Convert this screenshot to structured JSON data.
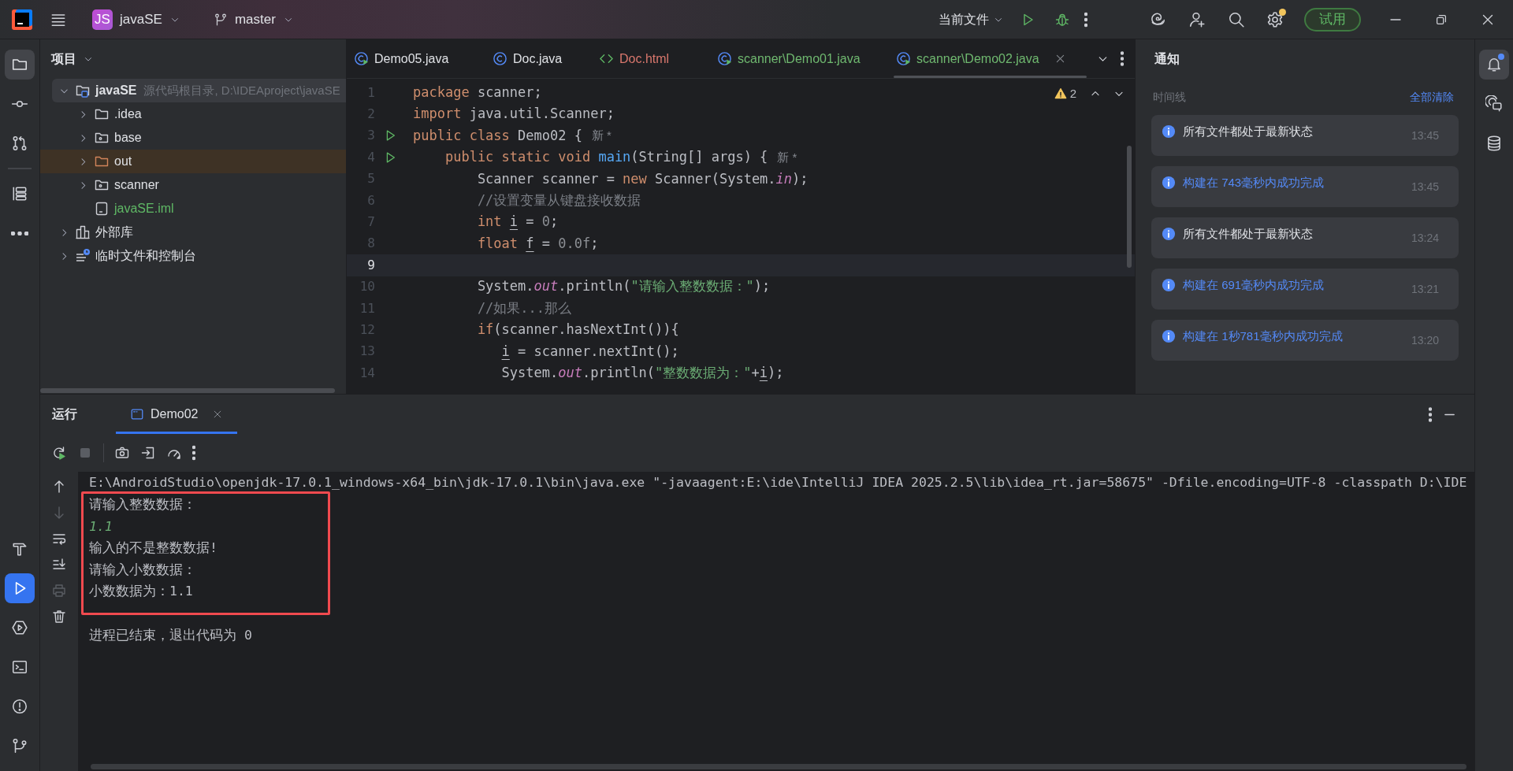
{
  "title_bar": {
    "project_badge": "JS",
    "project": "javaSE",
    "branch": "master",
    "run_config": "当前文件",
    "trial_button": "试用"
  },
  "left_toolbar": {
    "top": [
      {
        "selected": true
      },
      {
        "selected": false
      },
      {
        "selected": false
      },
      {
        "selected": false
      },
      {
        "selected": false
      }
    ],
    "bottom": [
      {
        "selected": false
      },
      {
        "selected": true
      },
      {
        "selected": false
      },
      {
        "selected": false
      },
      {
        "selected": false
      },
      {
        "selected": false
      }
    ]
  },
  "project_panel": {
    "title": "项目",
    "tree": [
      {
        "label": "javaSE",
        "hint": "源代码根目录, D:\\IDEAproject\\javaSE",
        "kind": "module",
        "expanded": true,
        "selected": true,
        "color": "#dfe1e5",
        "children": [
          {
            "label": ".idea",
            "kind": "folder",
            "expanded": false,
            "selected": false,
            "color": "#dfe1e5"
          },
          {
            "label": "base",
            "kind": "package",
            "expanded": false,
            "selected": false,
            "color": "#dfe1e5"
          },
          {
            "label": "out",
            "kind": "excluded",
            "expanded": false,
            "selected": false,
            "color": "#dfe1e5"
          },
          {
            "label": "scanner",
            "kind": "package",
            "expanded": false,
            "selected": false,
            "color": "#dfe1e5"
          },
          {
            "label": "javaSE.iml",
            "kind": "file",
            "selected": false,
            "color": "#5fb865"
          }
        ]
      },
      {
        "label": "外部库",
        "kind": "library",
        "expanded": false,
        "selected": false,
        "color": "#dfe1e5"
      },
      {
        "label": "临时文件和控制台",
        "kind": "scratches",
        "expanded": false,
        "selected": false,
        "color": "#dfe1e5"
      }
    ]
  },
  "editor": {
    "tabs": [
      {
        "label": "Demo05.java",
        "kind": "runnable-class",
        "color": "#dfe1e5",
        "selected": false
      },
      {
        "label": "Doc.java",
        "kind": "class",
        "color": "#dfe1e5",
        "selected": false
      },
      {
        "label": "Doc.html",
        "kind": "html",
        "color": "#d9776d",
        "selected": false
      },
      {
        "label": "scanner\\Demo01.java",
        "kind": "runnable-class",
        "color": "#6fb86f",
        "selected": false
      },
      {
        "label": "scanner\\Demo02.java",
        "kind": "runnable-class",
        "color": "#6fb86f",
        "selected": true
      }
    ],
    "warnings": "2",
    "lines": [
      {
        "number": "1",
        "current": false,
        "runnable": false,
        "segs": [
          {
            "keyword": "package"
          },
          {
            "plain": " scanner;"
          }
        ]
      },
      {
        "number": "2",
        "current": false,
        "runnable": false,
        "segs": [
          {
            "keyword": "import"
          },
          {
            "plain": " java.util.Scanner;"
          }
        ]
      },
      {
        "number": "3",
        "current": false,
        "runnable": true,
        "hint": "新 *",
        "segs": [
          {
            "keyword": "public class"
          },
          {
            "plain": " Demo02 {"
          }
        ]
      },
      {
        "number": "4",
        "current": false,
        "runnable": true,
        "hint": "新 *",
        "segs": [
          {
            "keyword": "    public static void "
          },
          {
            "function": "main"
          },
          {
            "plain": "(String[] args) {"
          }
        ]
      },
      {
        "number": "5",
        "current": false,
        "runnable": false,
        "segs": [
          {
            "plain": "        Scanner scanner = "
          },
          {
            "keyword": "new"
          },
          {
            "plain": " Scanner(System."
          },
          {
            "static_field": "in"
          },
          {
            "plain": ");"
          }
        ]
      },
      {
        "number": "6",
        "current": false,
        "runnable": false,
        "segs": [
          {
            "comment": "        //设置变量从键盘接收数据"
          }
        ]
      },
      {
        "number": "7",
        "current": false,
        "runnable": false,
        "segs": [
          {
            "keyword": "        int "
          },
          {
            "variable": "i"
          },
          {
            "plain": " = "
          },
          {
            "number": "0"
          },
          {
            "plain": ";"
          }
        ]
      },
      {
        "number": "8",
        "current": false,
        "runnable": false,
        "segs": [
          {
            "keyword": "        float "
          },
          {
            "variable": "f"
          },
          {
            "plain": " = "
          },
          {
            "number": "0.0f"
          },
          {
            "plain": ";"
          }
        ]
      },
      {
        "number": "9",
        "current": true,
        "runnable": false
      },
      {
        "number": "10",
        "current": false,
        "runnable": false,
        "segs": [
          {
            "plain": "        System."
          },
          {
            "static_field": "out"
          },
          {
            "plain": ".println("
          },
          {
            "string": "\"请输入整数数据：\""
          },
          {
            "plain": ");"
          }
        ]
      },
      {
        "number": "11",
        "current": false,
        "runnable": false,
        "segs": [
          {
            "comment": "        //如果...那么"
          }
        ]
      },
      {
        "number": "12",
        "current": false,
        "runnable": false,
        "segs": [
          {
            "keyword": "        if"
          },
          {
            "plain": "(scanner.hasNextInt()){"
          }
        ]
      },
      {
        "number": "13",
        "current": false,
        "runnable": false,
        "segs": [
          {
            "variable": "           i"
          },
          {
            "plain": " = scanner.nextInt();"
          }
        ]
      },
      {
        "number": "14",
        "current": false,
        "runnable": false,
        "segs": [
          {
            "plain": "           System."
          },
          {
            "static_field": "out"
          },
          {
            "plain": ".println("
          },
          {
            "string": "\"整数数据为：\""
          },
          {
            "plain": "+"
          },
          {
            "variable": "i"
          },
          {
            "plain": ");"
          }
        ]
      }
    ]
  },
  "notifications": {
    "title": "通知",
    "section": "时间线",
    "clear_all": "全部清除",
    "items": [
      {
        "message": "所有文件都处于最新状态",
        "time": "13:45",
        "link": false
      },
      {
        "message": "构建在 743毫秒内成功完成",
        "time": "13:45",
        "link": true
      },
      {
        "message": "所有文件都处于最新状态",
        "time": "13:24",
        "link": false
      },
      {
        "message": "构建在 691毫秒内成功完成",
        "time": "13:21",
        "link": true
      },
      {
        "message": "构建在 1秒781毫秒内成功完成",
        "time": "13:20",
        "link": true
      }
    ]
  },
  "run_panel": {
    "title": "运行",
    "tabs": [
      {
        "label": "Demo02",
        "selected": true
      }
    ],
    "toolbar": [
      {
        "disabled": false
      },
      {
        "disabled": true
      },
      {
        "disabled": false
      },
      {
        "disabled": false
      },
      {
        "disabled": false
      },
      {
        "disabled": false
      }
    ],
    "gutter": [
      {
        "disabled": false
      },
      {
        "disabled": true
      },
      {
        "disabled": false
      },
      {
        "disabled": false
      },
      {
        "disabled": true
      },
      {
        "disabled": false
      }
    ],
    "console": {
      "command": "E:\\AndroidStudio\\openjdk-17.0.1_windows-x64_bin\\jdk-17.0.1\\bin\\java.exe \"-javaagent:E:\\ide\\IntelliJ IDEA 2025.2.5\\lib\\idea_rt.jar=58675\" -Dfile.encoding=UTF-8 -classpath D:\\IDE",
      "highlighted": [
        {
          "text": "请输入整数数据：",
          "kind": "output"
        },
        {
          "text": "1.1",
          "kind": "input"
        },
        {
          "text": "输入的不是整数数据!",
          "kind": "output"
        },
        {
          "text": "请输入小数数据：",
          "kind": "output"
        },
        {
          "text": "小数数据为：1.1",
          "kind": "output"
        }
      ],
      "exit": "进程已结束，退出代码为 0"
    }
  }
}
